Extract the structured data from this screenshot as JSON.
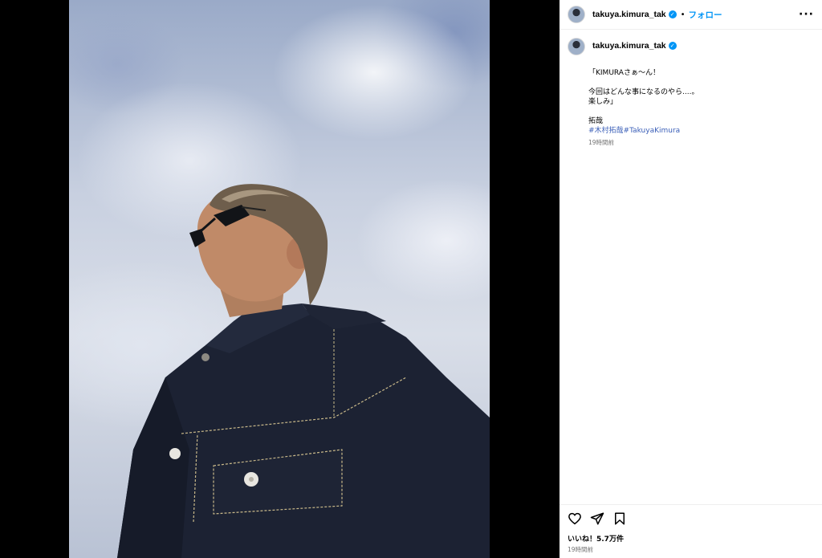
{
  "post": {
    "username": "takuya.kimura_tak",
    "follow_label": "フォロー",
    "separator": "•",
    "more_label": "···"
  },
  "caption": {
    "username": "takuya.kimura_tak",
    "lines": [
      "「KIMURAさぁ〜ん！",
      "今回はどんな事になるのやら....。",
      "楽しみ」",
      "拓哉"
    ],
    "hashtags": [
      "#木村拓哉",
      "#TakuyaKimura"
    ],
    "time": "19時間前"
  },
  "engagement": {
    "likes": "いいね！5.7万件",
    "time": "19時間前"
  },
  "icons": {
    "like": "heart-icon",
    "share": "share-icon",
    "save": "bookmark-icon",
    "verified": "verified-badge-icon",
    "more": "more-options-icon"
  },
  "colors": {
    "accent": "#0095f6",
    "hashtag": "#3b5fb8",
    "secondary_text": "#737373"
  }
}
